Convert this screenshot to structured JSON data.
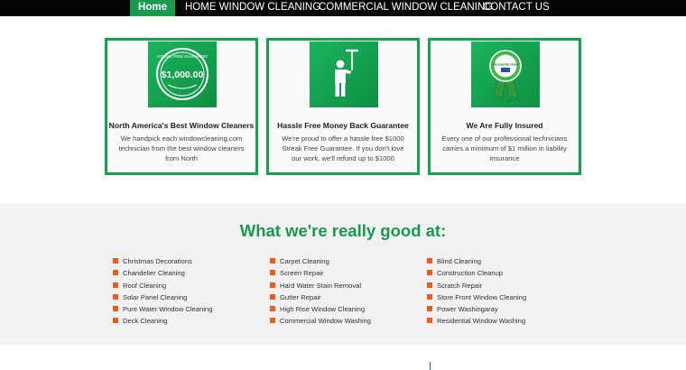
{
  "nav": {
    "home": "Home",
    "home_window_cleaning": "HOME WINDOW CLEANING",
    "commercial_window_cleaning": "COMMERCIAL WINDOW CLEANING",
    "contact_us": "CONTACT US"
  },
  "cards": [
    {
      "icon": "money-badge-icon",
      "badge_text": "$1,000.00",
      "badge_caption": "STREAK FREE GUARANTEE",
      "title": "North America's Best Window Cleaners",
      "description": "We handpick each windowcleaning.com technician from the best window cleaners from North"
    },
    {
      "icon": "window-cleaner-squeegee-icon",
      "title": "Hassle Free Money Back Guarantee",
      "description": "We're proud to offer a hassle free $1000 Streak Free Guarantee. If you don't love our work, we'll refund up to $1000"
    },
    {
      "icon": "insured-ribbon-icon",
      "badge_text": "Accounts Insd",
      "title": "We Are Fully Insured",
      "description": "Every one of our professional technicians carries a minimum of $1 million in liability insurance"
    }
  ],
  "services": {
    "heading": "What we're really good at:",
    "columns": [
      [
        "Christmas Decorations",
        "Chandelier Cleaning",
        "Roof Cleaning",
        "Solar Panel Cleaning",
        "Pure Water Window Cleaning",
        "Deck Cleaning"
      ],
      [
        "Carpet Cleaning",
        "Screen Repair",
        "Hard Water Stain Removal",
        "Gutter Repair",
        "High Rise Window Cleaning",
        "Commercial Window Washing"
      ],
      [
        "Blind Cleaning",
        "Construction Cleanup",
        "Scratch Repair",
        "Store Front Window Cleaning",
        "Power Washingaray",
        "Residential Window Washing"
      ]
    ]
  },
  "colors": {
    "brand_green": "#1a9a50",
    "card_border": "#14a34f",
    "bullet_orange": "#f05a1e",
    "nav_background": "#050505"
  }
}
